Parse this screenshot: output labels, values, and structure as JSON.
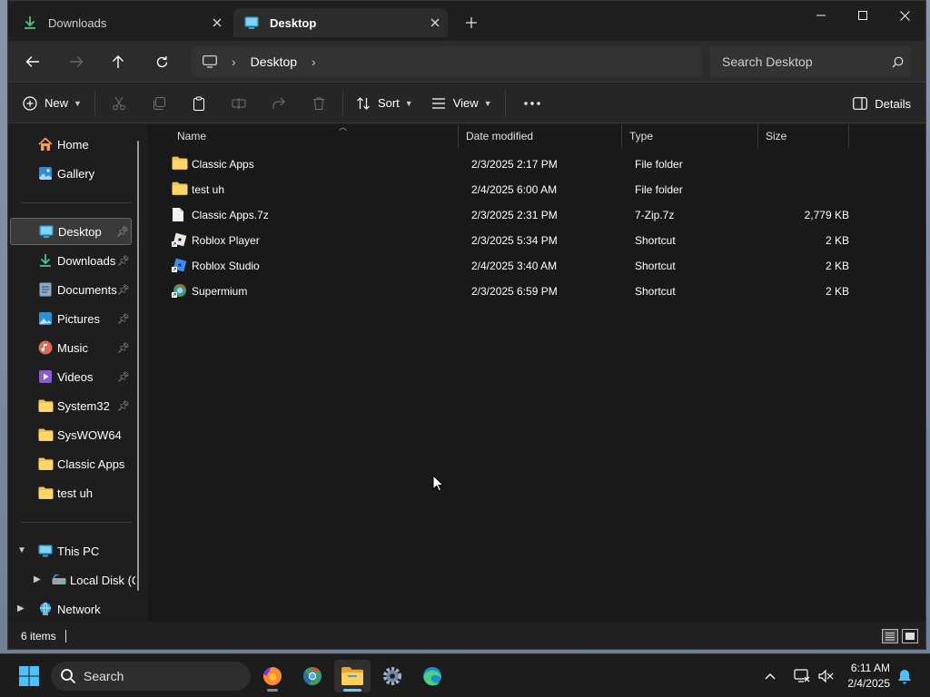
{
  "tabs": [
    {
      "label": "Downloads",
      "icon": "download-icon"
    },
    {
      "label": "Desktop",
      "icon": "desktop-icon"
    }
  ],
  "address": {
    "segments": [
      "Desktop"
    ]
  },
  "search": {
    "placeholder": "Search Desktop"
  },
  "commands": {
    "new": "New",
    "sort": "Sort",
    "view": "View",
    "details": "Details"
  },
  "sidebar": {
    "home": "Home",
    "gallery": "Gallery",
    "pinned": [
      {
        "label": "Desktop",
        "icon": "desktop-icon",
        "pinned": true,
        "selected": true
      },
      {
        "label": "Downloads",
        "icon": "download-icon",
        "pinned": true
      },
      {
        "label": "Documents",
        "icon": "documents-icon",
        "pinned": true
      },
      {
        "label": "Pictures",
        "icon": "pictures-icon",
        "pinned": true
      },
      {
        "label": "Music",
        "icon": "music-icon",
        "pinned": true
      },
      {
        "label": "Videos",
        "icon": "videos-icon",
        "pinned": true
      },
      {
        "label": "System32",
        "icon": "folder-icon",
        "pinned": true
      },
      {
        "label": "SysWOW64",
        "icon": "folder-icon",
        "pinned": false
      },
      {
        "label": "Classic Apps",
        "icon": "folder-icon",
        "pinned": false
      },
      {
        "label": "test uh",
        "icon": "folder-icon",
        "pinned": false
      }
    ],
    "this_pc": "This PC",
    "local_disk": "Local Disk (C:",
    "network": "Network"
  },
  "columns": {
    "name": "Name",
    "date": "Date modified",
    "type": "Type",
    "size": "Size"
  },
  "files": [
    {
      "name": "Classic Apps",
      "date": "2/3/2025 2:17 PM",
      "type": "File folder",
      "size": "",
      "icon": "folder-icon"
    },
    {
      "name": "test uh",
      "date": "2/4/2025 6:00 AM",
      "type": "File folder",
      "size": "",
      "icon": "folder-icon"
    },
    {
      "name": "Classic Apps.7z",
      "date": "2/3/2025 2:31 PM",
      "type": "7-Zip.7z",
      "size": "2,779 KB",
      "icon": "file-icon"
    },
    {
      "name": "Roblox Player",
      "date": "2/3/2025 5:34 PM",
      "type": "Shortcut",
      "size": "2 KB",
      "icon": "roblox-icon"
    },
    {
      "name": "Roblox Studio",
      "date": "2/4/2025 3:40 AM",
      "type": "Shortcut",
      "size": "2 KB",
      "icon": "roblox-studio-icon"
    },
    {
      "name": "Supermium",
      "date": "2/3/2025 6:59 PM",
      "type": "Shortcut",
      "size": "2 KB",
      "icon": "supermium-icon"
    }
  ],
  "status": {
    "count": "6 items"
  },
  "taskbar": {
    "search": "Search",
    "time": "6:11 AM",
    "date": "2/4/2025"
  },
  "colors": {
    "folder": "#f3c24b",
    "accent": "#60cdff",
    "window_bg": "#202020"
  }
}
